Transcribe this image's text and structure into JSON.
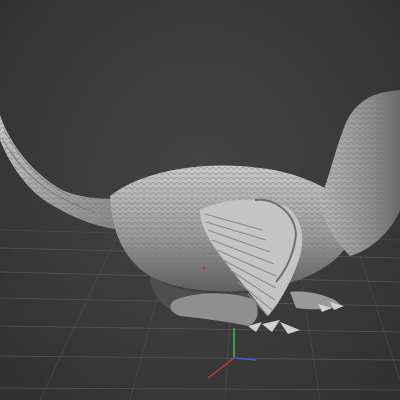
{
  "viewport": {
    "background": "#3a3a3a",
    "grid_color": "#5a5a5a",
    "model_color": "#a8a8a8",
    "model_shadow": "#5c5c5c",
    "model_highlight": "#d6d6d6"
  },
  "gizmo": {
    "x_axis_color": "#b33a3a",
    "y_axis_color": "#3fbf3f",
    "z_axis_color": "#3a5fd6"
  },
  "icons": {
    "model": "feathered-dinosaur-sculpt",
    "gizmo": "axis-gizmo-icon"
  }
}
